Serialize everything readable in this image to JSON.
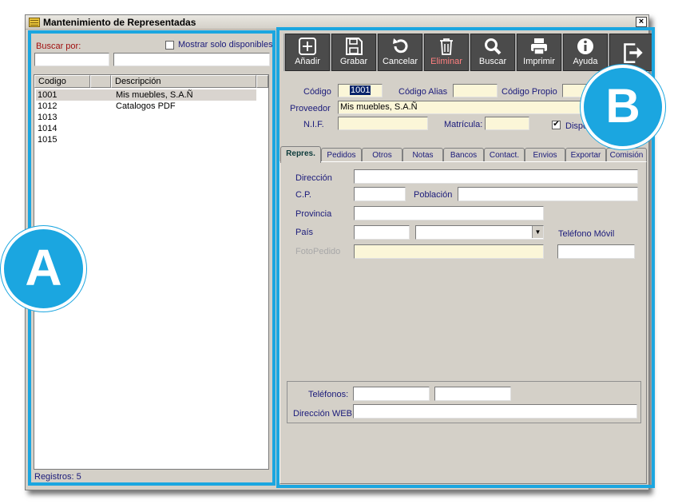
{
  "window": {
    "title": "Mantenimiento de Representadas",
    "close_label": "×"
  },
  "left": {
    "search_label": "Buscar por:",
    "show_available_label": "Mostrar solo disponibles",
    "columns": [
      "Codigo",
      "Descripción"
    ],
    "rows": [
      {
        "code": "1001",
        "desc": "Mis muebles, S.A.Ñ",
        "selected": true
      },
      {
        "code": "1012",
        "desc": "Catalogos PDF",
        "selected": false
      },
      {
        "code": "1013",
        "desc": "",
        "selected": false
      },
      {
        "code": "1014",
        "desc": "",
        "selected": false
      },
      {
        "code": "1015",
        "desc": "",
        "selected": false
      }
    ],
    "status": "Registros: 5"
  },
  "toolbar": {
    "buttons": [
      {
        "label": "Añadir",
        "icon": "plus-box-icon",
        "disabled": false
      },
      {
        "label": "Grabar",
        "icon": "floppy-disk-icon",
        "disabled": false
      },
      {
        "label": "Cancelar",
        "icon": "undo-icon",
        "disabled": false
      },
      {
        "label": "Eliminar",
        "icon": "trash-icon",
        "disabled": true
      },
      {
        "label": "Buscar",
        "icon": "magnifier-icon",
        "disabled": false
      },
      {
        "label": "Imprimir",
        "icon": "printer-icon",
        "disabled": false
      },
      {
        "label": "Ayuda",
        "icon": "info-icon",
        "disabled": false
      },
      {
        "label": "",
        "icon": "exit-icon",
        "disabled": false
      }
    ]
  },
  "header": {
    "codigo_label": "Código",
    "codigo_value": "1001",
    "alias_label": "Código Alias",
    "propio_label": "Código Propio",
    "proveedor_label": "Proveedor",
    "proveedor_value": "Mis muebles, S.A.Ñ",
    "nif_label": "N.I.F.",
    "matricula_label": "Matrícula:",
    "disponible_label": "Disponi"
  },
  "tabs": [
    "Repres.",
    "Pedidos",
    "Otros",
    "Notas",
    "Bancos",
    "Contact.",
    "Envios",
    "Exportar",
    "Comisión"
  ],
  "form": {
    "direccion_label": "Dirección",
    "cp_label": "C.P.",
    "poblacion_label": "Población",
    "provincia_label": "Provincia",
    "pais_label": "País",
    "movil_label": "Teléfono Móvil",
    "fotopedido_label": "FotoPedido",
    "telefonos_label": "Teléfonos:",
    "web_label": "Dirección WEB:"
  },
  "badges": {
    "a": "A",
    "b": "B"
  },
  "colors": {
    "highlight": "#1ba6e0",
    "toolbar_button": "#4b4b4b",
    "field_yellow": "#fbf6d8"
  }
}
